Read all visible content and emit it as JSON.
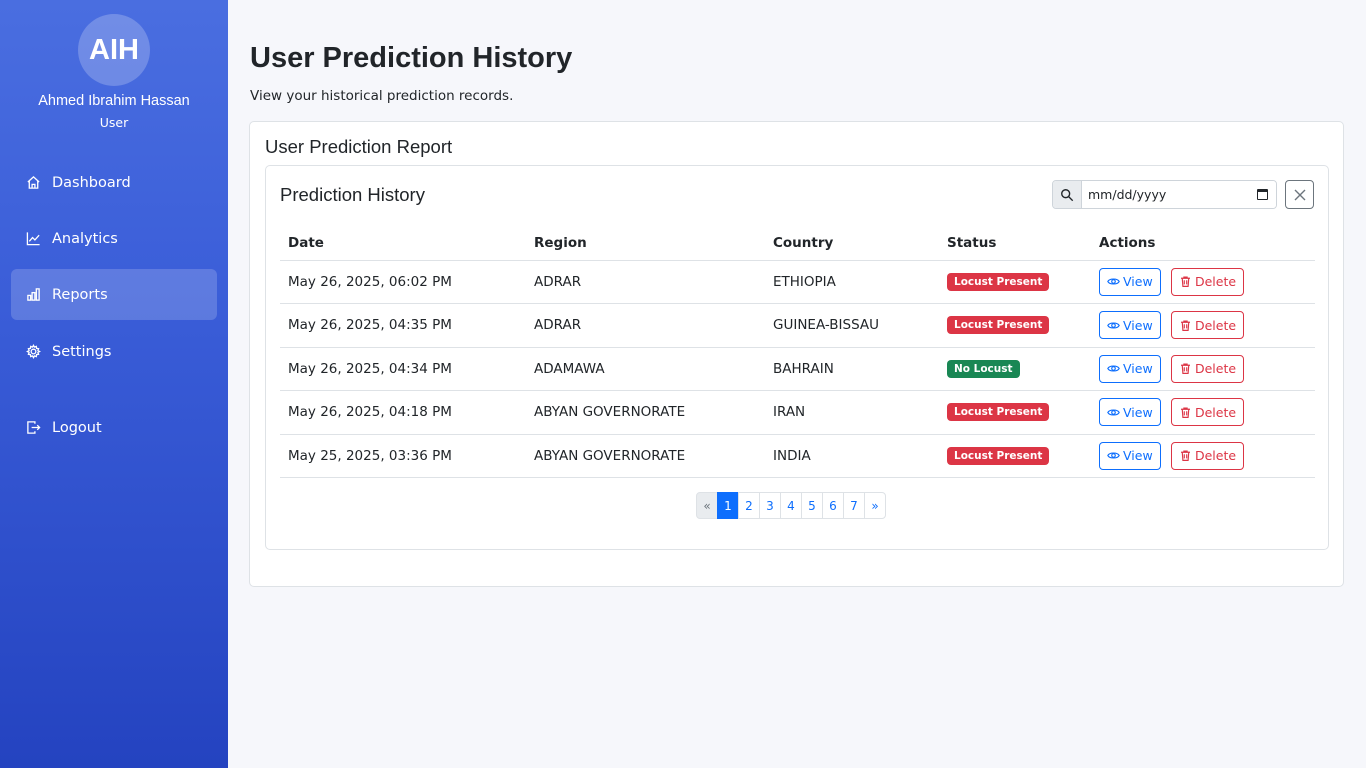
{
  "sidebar": {
    "avatar_initials": "AIH",
    "user_name": "Ahmed Ibrahim Hassan",
    "user_role": "User",
    "nav": [
      {
        "label": "Dashboard",
        "icon": "home-icon"
      },
      {
        "label": "Analytics",
        "icon": "chart-line-icon"
      },
      {
        "label": "Reports",
        "icon": "bar-chart-icon",
        "active": true
      },
      {
        "label": "Settings",
        "icon": "gear-icon"
      }
    ],
    "logout_label": "Logout"
  },
  "header": {
    "title": "User Prediction History",
    "subtitle": "View your historical prediction records."
  },
  "report": {
    "title": "User Prediction Report",
    "history_title": "Prediction History",
    "date_placeholder": "mm/dd/yyyy"
  },
  "table": {
    "headers": [
      "Date",
      "Region",
      "Country",
      "Status",
      "Actions"
    ],
    "rows": [
      {
        "date": "May 26, 2025, 06:02 PM",
        "region": "ADRAR",
        "country": "ETHIOPIA",
        "status": "Locust Present",
        "status_type": "danger"
      },
      {
        "date": "May 26, 2025, 04:35 PM",
        "region": "ADRAR",
        "country": "GUINEA-BISSAU",
        "status": "Locust Present",
        "status_type": "danger"
      },
      {
        "date": "May 26, 2025, 04:34 PM",
        "region": "ADAMAWA",
        "country": "BAHRAIN",
        "status": "No Locust",
        "status_type": "success"
      },
      {
        "date": "May 26, 2025, 04:18 PM",
        "region": "ABYAN GOVERNORATE",
        "country": "IRAN",
        "status": "Locust Present",
        "status_type": "danger"
      },
      {
        "date": "May 25, 2025, 03:36 PM",
        "region": "ABYAN GOVERNORATE",
        "country": "INDIA",
        "status": "Locust Present",
        "status_type": "danger"
      }
    ],
    "view_label": "View",
    "delete_label": "Delete"
  },
  "pagination": {
    "prev": "«",
    "pages": [
      "1",
      "2",
      "3",
      "4",
      "5",
      "6",
      "7"
    ],
    "active": "1",
    "next": "»"
  },
  "colors": {
    "primary": "#0d6efd",
    "danger": "#dc3545",
    "success": "#198754",
    "sidebar_gradient_top": "#4a6ee0",
    "sidebar_gradient_bottom": "#2443c0"
  }
}
